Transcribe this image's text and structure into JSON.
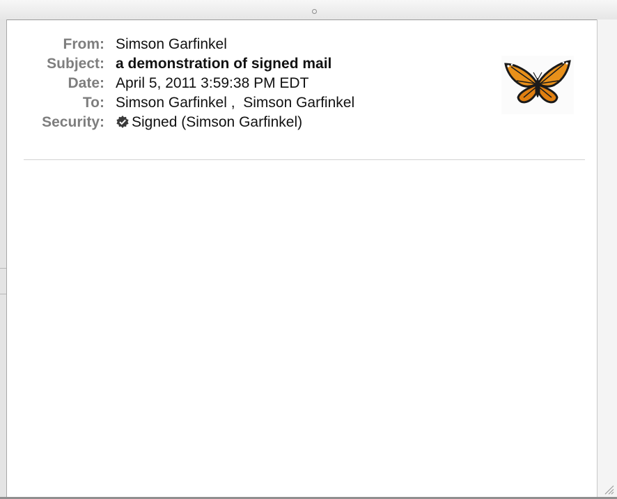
{
  "headers": {
    "from": {
      "label": "From:",
      "value": "Simson Garfinkel"
    },
    "subject": {
      "label": "Subject:",
      "value": "a demonstration of signed mail"
    },
    "date": {
      "label": "Date:",
      "value": "April 5, 2011 3:59:38 PM EDT"
    },
    "to": {
      "label": "To:",
      "recipient1": "Simson Garfinkel",
      "separator": " ,  ",
      "recipient2": "Simson Garfinkel"
    },
    "security": {
      "label": "Security:",
      "value": "Signed (Simson Garfinkel)",
      "icon": "verified-badge-icon"
    }
  },
  "avatar": {
    "icon": "butterfly-image"
  },
  "colors": {
    "label": "#7e7e7e",
    "value": "#111111",
    "divider": "#d2d2d2",
    "butterfly_orange": "#e8901a"
  }
}
